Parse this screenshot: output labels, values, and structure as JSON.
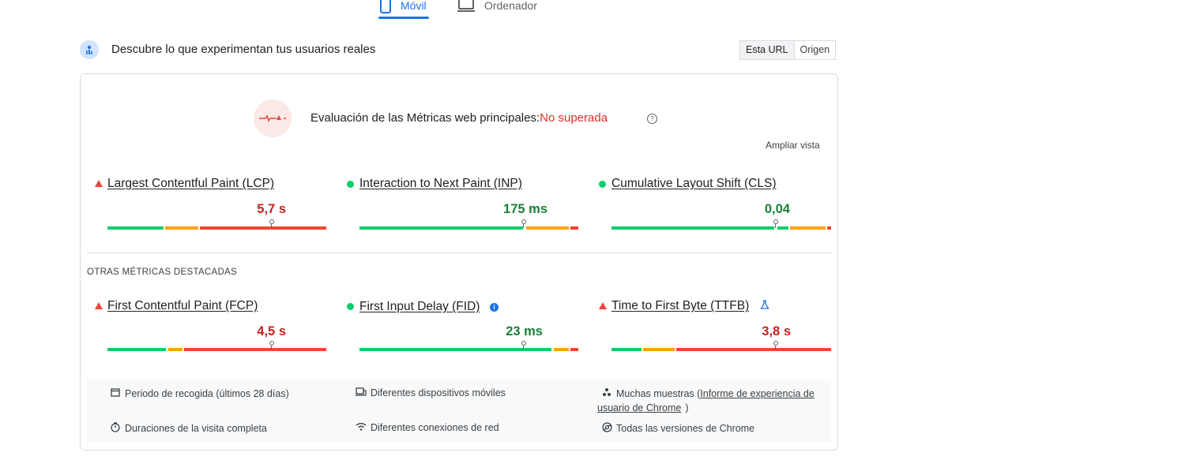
{
  "device_tabs": [
    {
      "label": "Móvil",
      "icon": "phone-icon",
      "active": true
    },
    {
      "label": "Ordenador",
      "icon": "laptop-icon",
      "active": false
    }
  ],
  "header": {
    "title": "Descubre lo que experimentan tus usuarios reales",
    "icon": "crux-people-icon",
    "toggle": [
      "Esta URL",
      "Origen"
    ]
  },
  "assessment": {
    "title": "Evaluación de las Métricas web principales:",
    "status": "No superada",
    "expand_label": "Ampliar vista"
  },
  "core_metrics": [
    {
      "name": "Largest Contentful Paint (LCP)",
      "value": "5,7 s",
      "rating": "poor"
    },
    {
      "name": "Interaction to Next Paint (INP)",
      "value": "175 ms",
      "rating": "good"
    },
    {
      "name": "Cumulative Layout Shift (CLS)",
      "value": "0,04",
      "rating": "good"
    }
  ],
  "other_section_label": "OTRAS MÉTRICAS DESTACADAS",
  "other_metrics": [
    {
      "name": "First Contentful Paint (FCP)",
      "value": "4,5 s",
      "rating": "poor"
    },
    {
      "name": "First Input Delay (FID)",
      "value": "23 ms",
      "rating": "good"
    },
    {
      "name": "Time to First Byte (TTFB)",
      "value": "3,8 s",
      "rating": "poor"
    }
  ],
  "footer": {
    "period": "Periodo de recogida (últimos 28 días)",
    "devices": "Diferentes dispositivos móviles",
    "samples_prefix": "Muchas muestras (",
    "samples_link_1": "Informe de experiencia de",
    "samples_link_2": "usuario de Chrome",
    "samples_suffix": ")",
    "durations": "Duraciones de la visita completa",
    "connections": "Diferentes conexiones de red",
    "versions": "Todas las versiones de Chrome"
  },
  "colors": {
    "good": "#0cce6b",
    "average": "#ffa400",
    "poor": "#f4442e",
    "accent": "#1a73e8"
  }
}
